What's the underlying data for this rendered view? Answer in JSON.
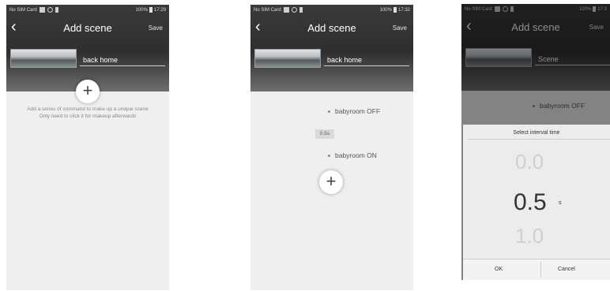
{
  "screens": [
    {
      "status": {
        "left": "No SIM Card",
        "battery": "100%",
        "time": "17:29"
      },
      "title": "Add scene",
      "save_label": "Save",
      "scene_name": "back home",
      "add_symbol": "+",
      "hint_line1": "Add a series of command to make up a unique scene",
      "hint_line2": "Only need to click it for makeup afterwards"
    },
    {
      "status": {
        "left": "No SIM Card",
        "battery": "100%",
        "time": "17:32"
      },
      "title": "Add scene",
      "save_label": "Save",
      "scene_name": "back home",
      "actions": [
        "babyroom OFF",
        "babyroom ON"
      ],
      "interval": "0.5s",
      "add_symbol": "+"
    },
    {
      "status": {
        "left": "No SIM Card",
        "battery": "100%",
        "time": "17:3"
      },
      "title": "Add scene",
      "save_label": "Save",
      "scene_name": "Scene",
      "actions": [
        "babyroom OFF"
      ],
      "dialog": {
        "title": "Select interval time",
        "values": [
          "0.0",
          "0.5",
          "1.0"
        ],
        "unit": "s",
        "ok": "OK",
        "cancel": "Cancel"
      }
    }
  ]
}
